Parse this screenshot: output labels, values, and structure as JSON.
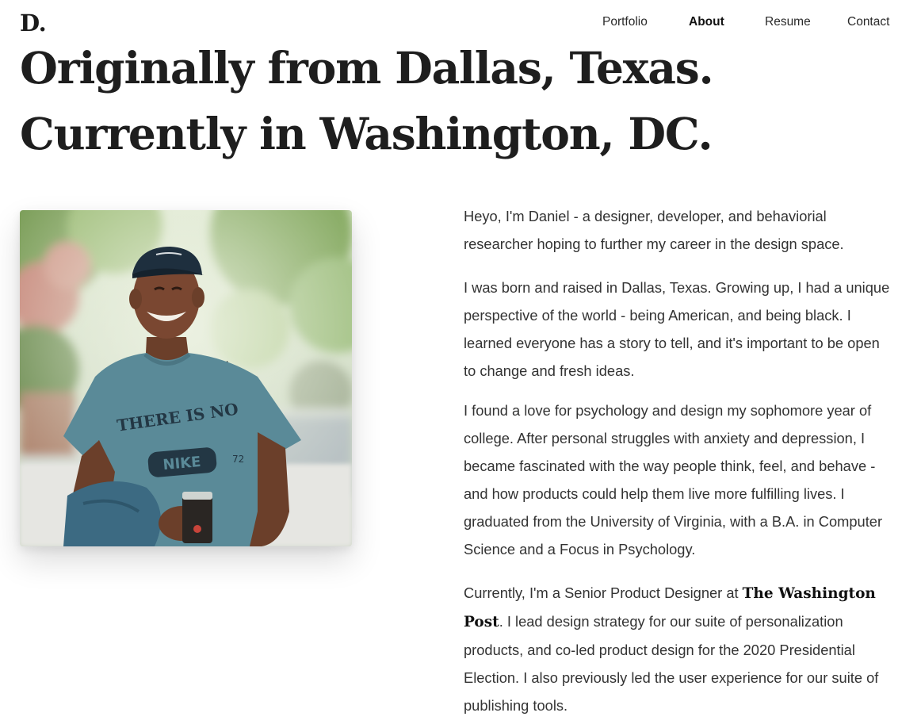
{
  "logo": "D.",
  "nav": {
    "items": [
      {
        "label": "Portfolio",
        "active": false
      },
      {
        "label": "About",
        "active": true
      },
      {
        "label": "Resume",
        "active": false
      },
      {
        "label": "Contact",
        "active": false
      }
    ]
  },
  "headline": {
    "line1": "Originally from Dallas, Texas.",
    "line2": "Currently in Washington, DC."
  },
  "photo": {
    "shirt_text": "THERE IS NO",
    "shirt_logo": "NIKE",
    "shirt_number": "72"
  },
  "bio": {
    "p1": "Heyo, I'm Daniel - a designer, developer, and behaviorial researcher hoping to further my career in the design space.",
    "p2": "I was born and raised in Dallas, Texas. Growing up, I had a unique perspective of the world - being American, and being black. I learned everyone has a story to tell, and it's important to be open to change and fresh ideas.",
    "p3": "I found a love for psychology and design my sophomore year of college. After personal struggles with anxiety and depression, I became fascinated with the way people think, feel, and behave - and how products could help them live more fulfilling lives. I graduated from the University of Virginia, with a B.A. in Computer Science and a Focus in Psychology.",
    "p4_before": "Currently, I'm a Senior Product Designer at ",
    "p4_employer": "The Washington Post",
    "p4_after": ". I lead design strategy for our suite of personalization products, and co-led product design for the 2020 Presidential Election. I also previously led the user experience for our suite of publishing tools."
  },
  "colors": {
    "text": "#222222",
    "body_text": "#333333",
    "background": "#ffffff",
    "shirt": "#5a8a98",
    "cap": "#1e2f3e"
  }
}
